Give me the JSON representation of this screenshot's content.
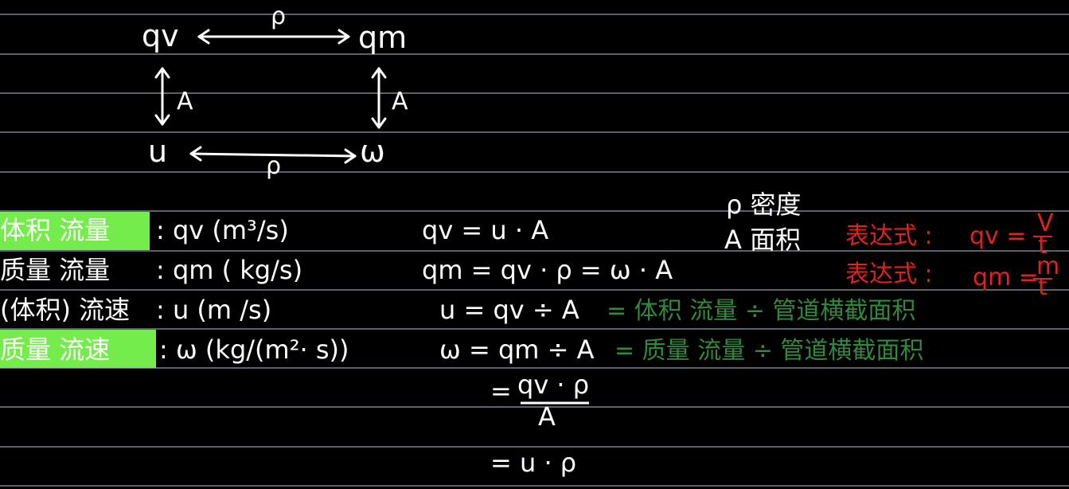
{
  "diagram": {
    "node_qv": "qv",
    "node_qm": "qm",
    "node_u": "u",
    "node_w": "ω",
    "label_rho_top": "ρ",
    "label_rho_bottom": "ρ",
    "label_A_left": "A",
    "label_A_right": "A"
  },
  "legend": {
    "rho_line": "ρ 密度",
    "area_line": "A 面积"
  },
  "rows": [
    {
      "term": "体积 流量",
      "quantity": ":  qv  (m³/s)",
      "formula": "qv =  u · A",
      "note": ""
    },
    {
      "term": "质量 流量",
      "quantity": ":  qm  ( kg/s)",
      "formula": "qm =  qv · ρ = ω · A",
      "note": ""
    },
    {
      "term": "(体积) 流速",
      "quantity": ":  u  (m /s)",
      "formula": "u =  qv ÷ A",
      "note": "= 体积 流量 ÷ 管道横截面积"
    },
    {
      "term": "质量 流速",
      "quantity": ":  ω  (kg/(m²· s))",
      "formula": "ω = qm ÷ A",
      "note": "= 质量 流量 ÷ 管道横截面积"
    }
  ],
  "expressions": [
    {
      "label": "表达式 :",
      "formula": "qv =",
      "numerator": "V",
      "denominator": "t"
    },
    {
      "label": "表达式 :",
      "formula": "qm =",
      "numerator": "m",
      "denominator": "t"
    }
  ],
  "derivation": {
    "step1_prefix": "=",
    "step1_numerator": "qv · ρ",
    "step1_denominator": "A",
    "step2": "= u · ρ"
  },
  "colors": {
    "background": "#000000",
    "ruled_line": "#b9c3d6",
    "ink": "#ffffff",
    "highlight": "#74ec4b",
    "note_green": "#2f8a3c",
    "expression_red": "#e0211d"
  }
}
